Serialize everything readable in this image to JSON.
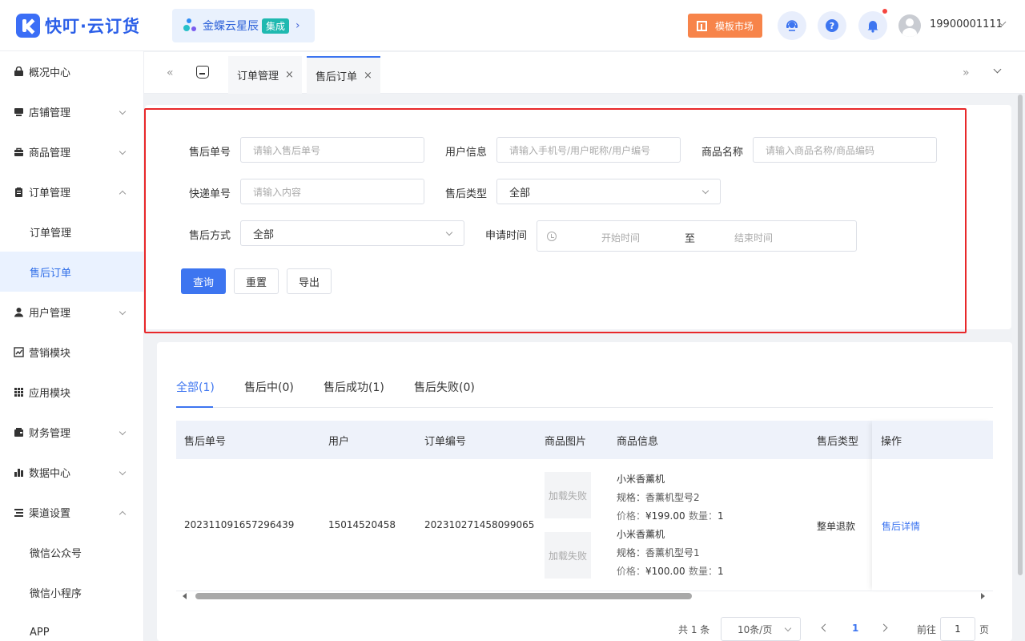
{
  "header": {
    "app_title": "快叮·云订货",
    "brand": {
      "name": "金蝶云星辰",
      "tag": "集成",
      "arrow": "›"
    },
    "market_label": "模板市场",
    "user": "19900001111"
  },
  "sidebar": {
    "items": [
      {
        "label": "概况中心"
      },
      {
        "label": "店铺管理"
      },
      {
        "label": "商品管理"
      },
      {
        "label": "订单管理"
      },
      {
        "label": "订单管理"
      },
      {
        "label": "售后订单"
      },
      {
        "label": "用户管理"
      },
      {
        "label": "营销模块"
      },
      {
        "label": "应用模块"
      },
      {
        "label": "财务管理"
      },
      {
        "label": "数据中心"
      },
      {
        "label": "渠道设置"
      },
      {
        "label": "微信公众号"
      },
      {
        "label": "微信小程序"
      },
      {
        "label": "APP"
      }
    ]
  },
  "tabs": {
    "left_arrows": "«",
    "right_arrows": "»",
    "items": [
      {
        "label": "订单管理",
        "close": "×"
      },
      {
        "label": "售后订单",
        "close": "×"
      }
    ]
  },
  "filters": {
    "after_sale_no": {
      "label": "售后单号",
      "placeholder": "请输入售后单号"
    },
    "user_info": {
      "label": "用户信息",
      "placeholder": "请输入手机号/用户昵称/用户编号"
    },
    "goods_name": {
      "label": "商品名称",
      "placeholder": "请输入商品名称/商品编码"
    },
    "express_no": {
      "label": "快递单号",
      "placeholder": "请输入内容"
    },
    "after_sale_type": {
      "label": "售后类型",
      "value": "全部"
    },
    "after_sale_method": {
      "label": "售后方式",
      "value": "全部"
    },
    "apply_time": {
      "label": "申请时间",
      "start": "开始时间",
      "sep": "至",
      "end": "结束时间"
    },
    "buttons": {
      "query": "查询",
      "reset": "重置",
      "export": "导出"
    }
  },
  "status_tabs": [
    {
      "label": "全部(1)"
    },
    {
      "label": "售后中(0)"
    },
    {
      "label": "售后成功(1)"
    },
    {
      "label": "售后失败(0)"
    }
  ],
  "table": {
    "columns": [
      "售后单号",
      "用户",
      "订单编号",
      "商品图片",
      "商品信息",
      "售后类型",
      "操作"
    ],
    "row": {
      "after_sale_no": "202311091657296439",
      "user": "15014520458",
      "order_no": "202310271458099065",
      "img_fail": "加载失败",
      "goods": [
        {
          "name": "小米香薰机",
          "spec": "规格：香薰机型号2",
          "price_label": "价格：",
          "price": "¥199.00",
          "qty_label": "数量：",
          "qty": "1"
        },
        {
          "name": "小米香薰机",
          "spec": "规格：香薰机型号1",
          "price_label": "价格：",
          "price": "¥100.00",
          "qty_label": "数量：",
          "qty": "1"
        }
      ],
      "type": "整单退款",
      "action": "售后详情"
    }
  },
  "pagination": {
    "total": "共 1 条",
    "page_size": "10条/页",
    "current": "1",
    "goto": "前往",
    "page_input": "1",
    "unit": "页"
  },
  "colors": {
    "primary": "#3d75f0",
    "market": "#f7844a",
    "highlight_frame": "#e8282a"
  },
  "icons": [
    "logo-icon",
    "grid-icon",
    "service-icon",
    "help-icon",
    "bell-icon",
    "avatar-icon",
    "home-icon",
    "clock-icon"
  ]
}
